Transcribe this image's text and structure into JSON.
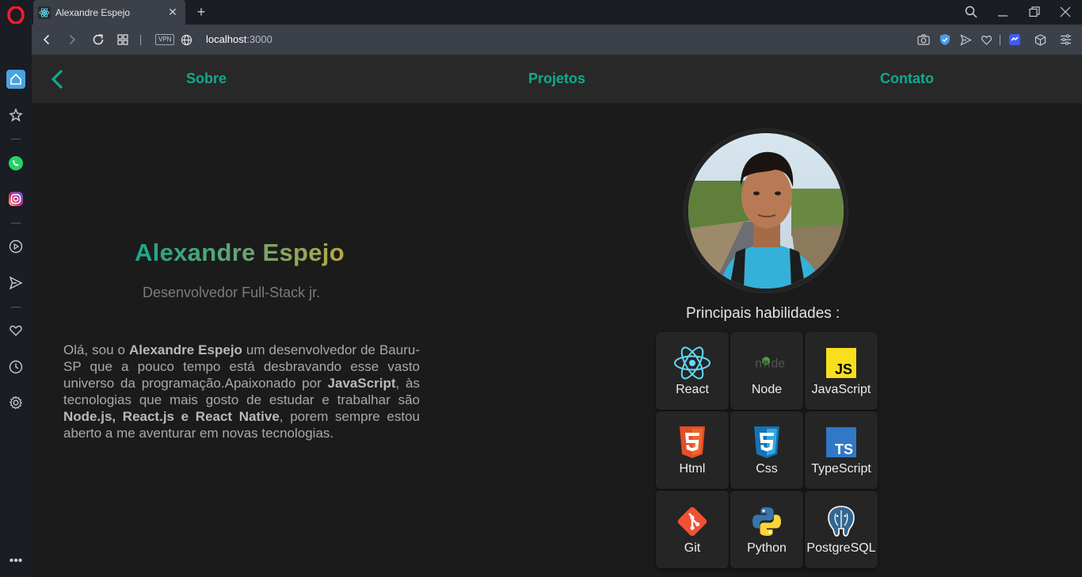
{
  "browser": {
    "tab_title": "Alexandre Espejo",
    "new_tab_symbol": "+",
    "close_symbol": "✕",
    "vpn_label": "VPN",
    "url_host": "localhost",
    "url_port": ":3000"
  },
  "nav": {
    "links": [
      "Sobre",
      "Projetos",
      "Contato"
    ]
  },
  "hero": {
    "name": "Alexandre Espejo",
    "role": "Desenvolvedor Full-Stack jr."
  },
  "bio": {
    "p1": "Olá, sou o ",
    "name": "Alexandre Espejo",
    "p2": " um desenvolvedor de Bauru-SP que a pouco tempo está desbravando esse vasto universo da programação.Apaixonado por ",
    "js": "JavaScript",
    "p3": ", às tecnologias que mais gosto de estudar e trabalhar são ",
    "techs": "Node.js, React.js e React Native",
    "p4": ", porem sempre estou aberto a me aventurar em novas tecnologias."
  },
  "skills": {
    "title": "Principais habilidades :",
    "items": [
      {
        "label": "React",
        "icon": "react-icon"
      },
      {
        "label": "Node",
        "icon": "node-icon"
      },
      {
        "label": "JavaScript",
        "icon": "javascript-icon"
      },
      {
        "label": "Html",
        "icon": "html5-icon"
      },
      {
        "label": "Css",
        "icon": "css3-icon"
      },
      {
        "label": "TypeScript",
        "icon": "typescript-icon"
      },
      {
        "label": "Git",
        "icon": "git-icon"
      },
      {
        "label": "Python",
        "icon": "python-icon"
      },
      {
        "label": "PostgreSQL",
        "icon": "postgresql-icon"
      }
    ]
  },
  "colors": {
    "accent": "#13a98e",
    "background": "#1b1b1b",
    "navbar": "#282828",
    "card": "#252525"
  }
}
